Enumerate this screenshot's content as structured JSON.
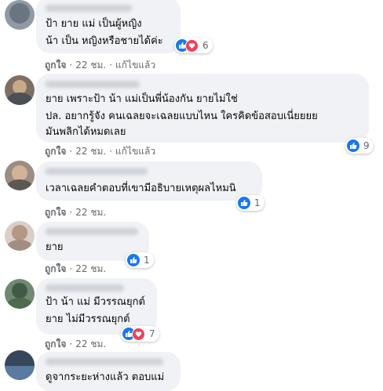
{
  "comments": [
    {
      "lines": [
        "ป้า ยาย แม่ เป็นผู้หญิง",
        "น้า เป็น หญิงหรือชายได้ค่ะ"
      ],
      "reactions": {
        "types": [
          "like-icon",
          "love-icon"
        ],
        "count": "6"
      },
      "actions": {
        "like": "ถูกใจ",
        "time": "22 ชม.",
        "edited": "แก้ไขแล้ว"
      }
    },
    {
      "lines": [
        "ยาย เพราะป้า น้า แม่เป็นพี่น้องกัน ยายไม่ใช่",
        "ปล. อยากรู้จัง คนเฉลยจะเฉลยแบบไหน ใครคิดข้อสอบเนี่ยยยย",
        "มันพลิกได้หมดเลย"
      ],
      "reactions": {
        "types": [
          "like-icon"
        ],
        "count": "9"
      },
      "actions": {
        "like": "ถูกใจ",
        "time": "22 ชม.",
        "edited": "แก้ไขแล้ว"
      }
    },
    {
      "lines": [
        "เวลาเฉลยคำตอบที่เขามีอธิบายเหตุผลไหมนิ"
      ],
      "reactions": {
        "types": [
          "like-icon"
        ],
        "count": "1"
      },
      "actions": {
        "like": "ถูกใจ",
        "time": "22 ชม."
      }
    },
    {
      "lines": [
        "ยาย"
      ],
      "reactions": {
        "types": [
          "like-icon"
        ],
        "count": "1"
      },
      "actions": {
        "like": "ถูกใจ",
        "time": "22 ชม."
      }
    },
    {
      "lines": [
        "ป้า น้า แม่ มีวรรณยุกต์",
        "ยาย ไม่มีวรรณยุกต์"
      ],
      "reactions": {
        "types": [
          "like-icon",
          "love-icon"
        ],
        "count": "7"
      },
      "actions": {
        "like": "ถูกใจ",
        "time": "22 ชม."
      }
    },
    {
      "lines": [
        "ดูจากระยะห่างแล้ว ตอบแม่"
      ],
      "reactions": null,
      "actions": null
    }
  ],
  "colors": {
    "like": "#1877f2",
    "love": "#f33e58",
    "bubble": "#f0f2f5",
    "meta": "#65676b"
  }
}
